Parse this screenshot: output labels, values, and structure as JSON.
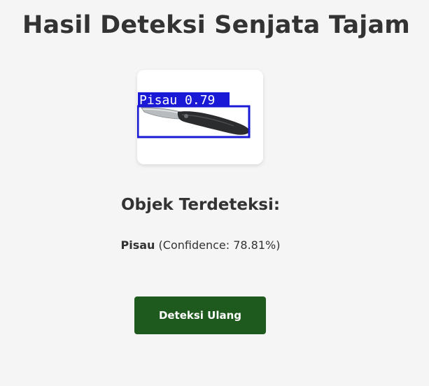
{
  "page": {
    "title": "Hasil Deteksi Senjata Tajam"
  },
  "detection_image": {
    "icon": "knife-detection-image",
    "label": "Pisau 0.79",
    "box_color": "#1a1ad6"
  },
  "results": {
    "heading": "Objek Terdeteksi:",
    "items": [
      {
        "name": "Pisau",
        "confidence_text": "(Confidence: 78.81%)"
      }
    ]
  },
  "actions": {
    "retry_label": "Deteksi Ulang",
    "retry_color": "#1e5a1e"
  }
}
